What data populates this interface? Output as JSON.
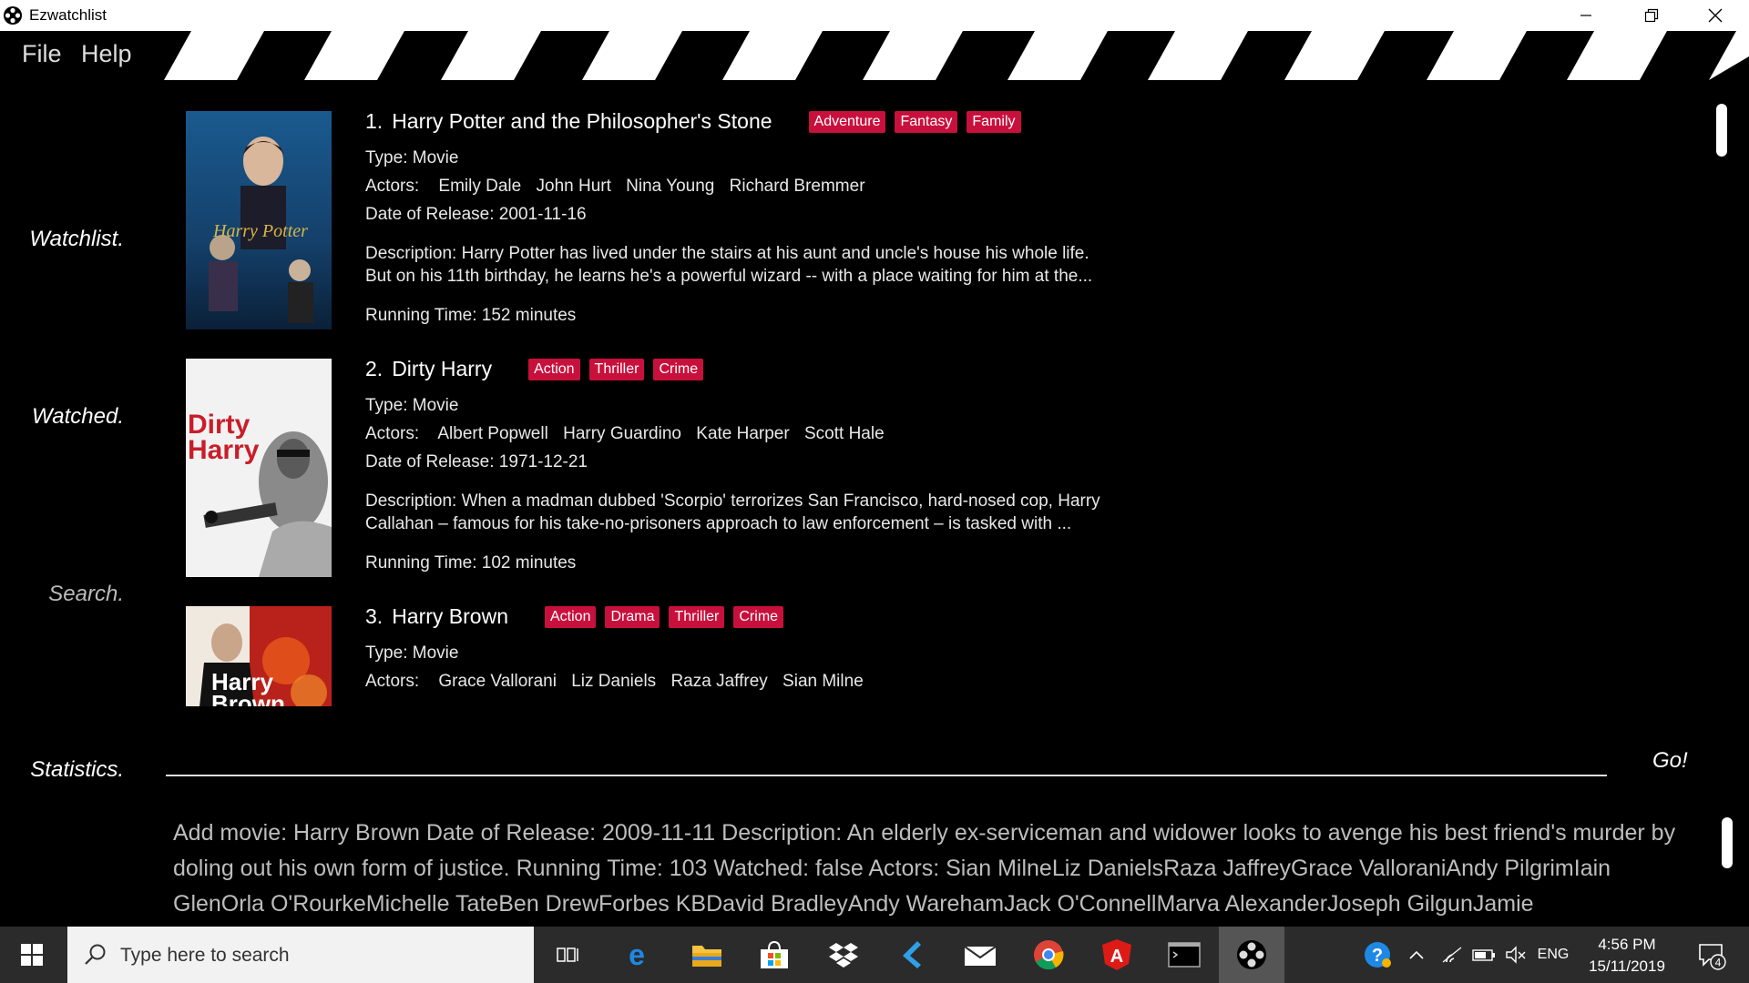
{
  "window": {
    "title": "Ezwatchlist"
  },
  "menu": {
    "file": "File",
    "help": "Help"
  },
  "sidebar": {
    "watchlist": "Watchlist.",
    "watched": "Watched.",
    "search": "Search.",
    "statistics": "Statistics."
  },
  "shows": [
    {
      "num": "1.",
      "title": "Harry Potter and the Philosopher's Stone",
      "tags": [
        "Adventure",
        "Fantasy",
        "Family"
      ],
      "type": "Type: Movie",
      "actors_label": "Actors:",
      "actors": [
        "Emily Dale",
        "John Hurt",
        "Nina Young",
        "Richard Bremmer"
      ],
      "date": "Date of Release: 2001-11-16",
      "desc1": "Description: Harry Potter has lived under the stairs at his aunt and uncle's house his whole life.",
      "desc2": "But on his 11th birthday, he learns he's a powerful wizard -- with a place waiting for him at the...",
      "runtime": "Running Time: 152 minutes",
      "poster_text": "Harry Potter"
    },
    {
      "num": "2.",
      "title": "Dirty Harry",
      "tags": [
        "Action",
        "Thriller",
        "Crime"
      ],
      "type": "Type: Movie",
      "actors_label": "Actors:",
      "actors": [
        "Albert Popwell",
        "Harry Guardino",
        "Kate Harper",
        "Scott Hale"
      ],
      "date": "Date of Release: 1971-12-21",
      "desc1": "Description: When a madman dubbed 'Scorpio' terrorizes San Francisco, hard-nosed cop, Harry",
      "desc2": "Callahan – famous for his take-no-prisoners approach to law enforcement – is tasked with ...",
      "runtime": "Running Time: 102 minutes",
      "poster_text1": "Dirty",
      "poster_text2": "Harry"
    },
    {
      "num": "3.",
      "title": "Harry Brown",
      "tags": [
        "Action",
        "Drama",
        "Thriller",
        "Crime"
      ],
      "type": "Type: Movie",
      "actors_label": "Actors:",
      "actors": [
        "Grace Vallorani",
        "Liz Daniels",
        "Raza Jaffrey",
        "Sian Milne"
      ],
      "poster_text1": "Harry",
      "poster_text2": "Brown"
    }
  ],
  "command": {
    "go": "Go!"
  },
  "result": "Add movie: Harry Brown Date of Release: 2009-11-11 Description: An elderly ex-serviceman and widower looks to avenge his best friend's murder by doling out his own form of justice. Running Time: 103 Watched: false Actors: Sian MilneLiz DanielsRaza JaffreyGrace ValloraniAndy PilgrimIain GlenOrla O'RourkeMichelle TateBen DrewForbes KBDavid BradleyAndy WarehamJack O'ConnellMarva AlexanderJoseph GilgunJamie DowneyRadoslaw",
  "taskbar": {
    "search_placeholder": "Type here to search",
    "time": "4:56 PM",
    "date": "15/11/2019",
    "lang": "ENG",
    "notifications": "4"
  },
  "colors": {
    "tag": "#c8103c",
    "background": "#000000",
    "taskbar": "#2b2b2b"
  }
}
